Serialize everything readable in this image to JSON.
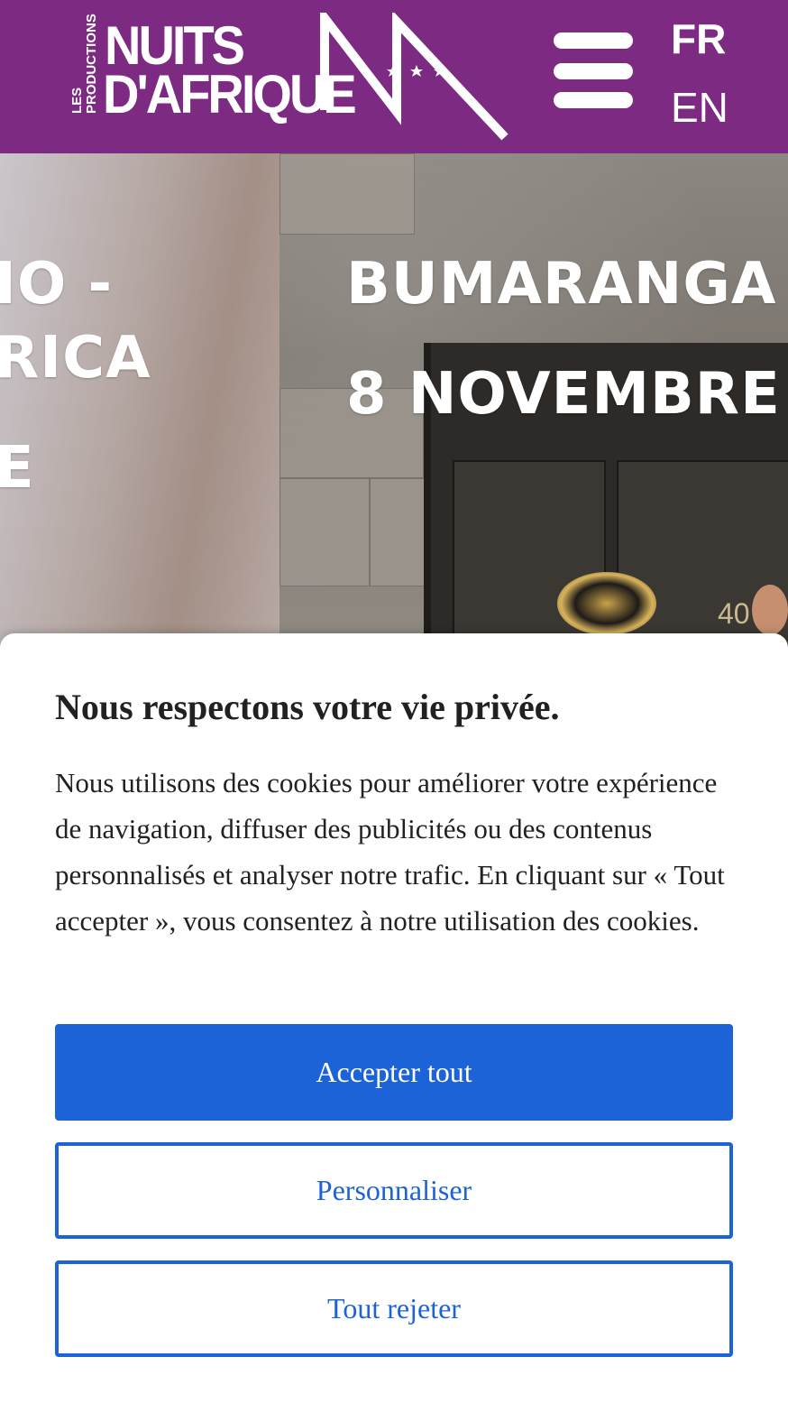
{
  "header": {
    "logo": {
      "small_line1": "LES",
      "small_line2": "PRODUCTIONS",
      "line1": "NUITS",
      "line2": "D'AFRIQUE"
    },
    "menu_icon": "hamburger-menu-icon",
    "languages": [
      {
        "code": "FR",
        "active": true
      },
      {
        "code": "EN",
        "active": false
      }
    ]
  },
  "hero": {
    "slide_left": {
      "line1": "IO -",
      "line2": "RICA",
      "line3": "E"
    },
    "slide_right": {
      "line1": "BUMARANGA",
      "line2": "8 NOVEMBRE",
      "door_number": "40"
    }
  },
  "cookie_banner": {
    "title": "Nous respectons votre vie privée.",
    "body": "Nous utilisons des cookies pour améliorer votre expérience de navigation, diffuser des publicités ou des contenus personnalisés et analyser notre trafic. En cliquant sur « Tout accepter », vous consentez à notre utilisation des cookies.",
    "buttons": {
      "accept": "Accepter tout",
      "customize": "Personnaliser",
      "reject": "Tout rejeter"
    }
  },
  "colors": {
    "header_bg": "#7d2a82",
    "primary_blue": "#1c63d8",
    "text_dark": "#212121"
  }
}
